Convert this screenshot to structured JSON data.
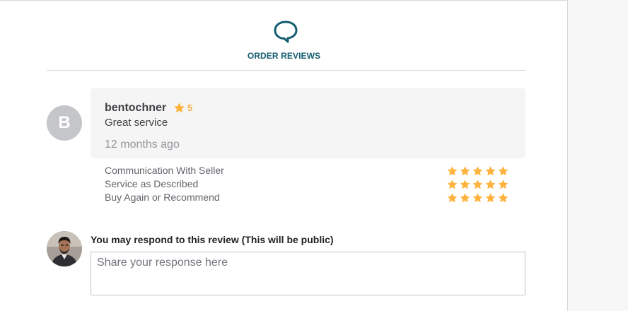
{
  "section": {
    "title": "ORDER REVIEWS",
    "icon": "speech-bubble-icon",
    "accent_color": "#135d6f"
  },
  "review": {
    "avatar_initial": "B",
    "reviewer": "bentochner",
    "rating": "5",
    "text": "Great service",
    "time_ago": "12 months ago",
    "star_color": "#ffb33e"
  },
  "criteria": [
    {
      "label": "Communication With Seller",
      "stars": 5
    },
    {
      "label": "Service as Described",
      "stars": 5
    },
    {
      "label": "Buy Again or Recommend",
      "stars": 5
    }
  ],
  "response": {
    "label": "You may respond to this review (This will be public)",
    "placeholder": "Share your response here",
    "value": ""
  }
}
